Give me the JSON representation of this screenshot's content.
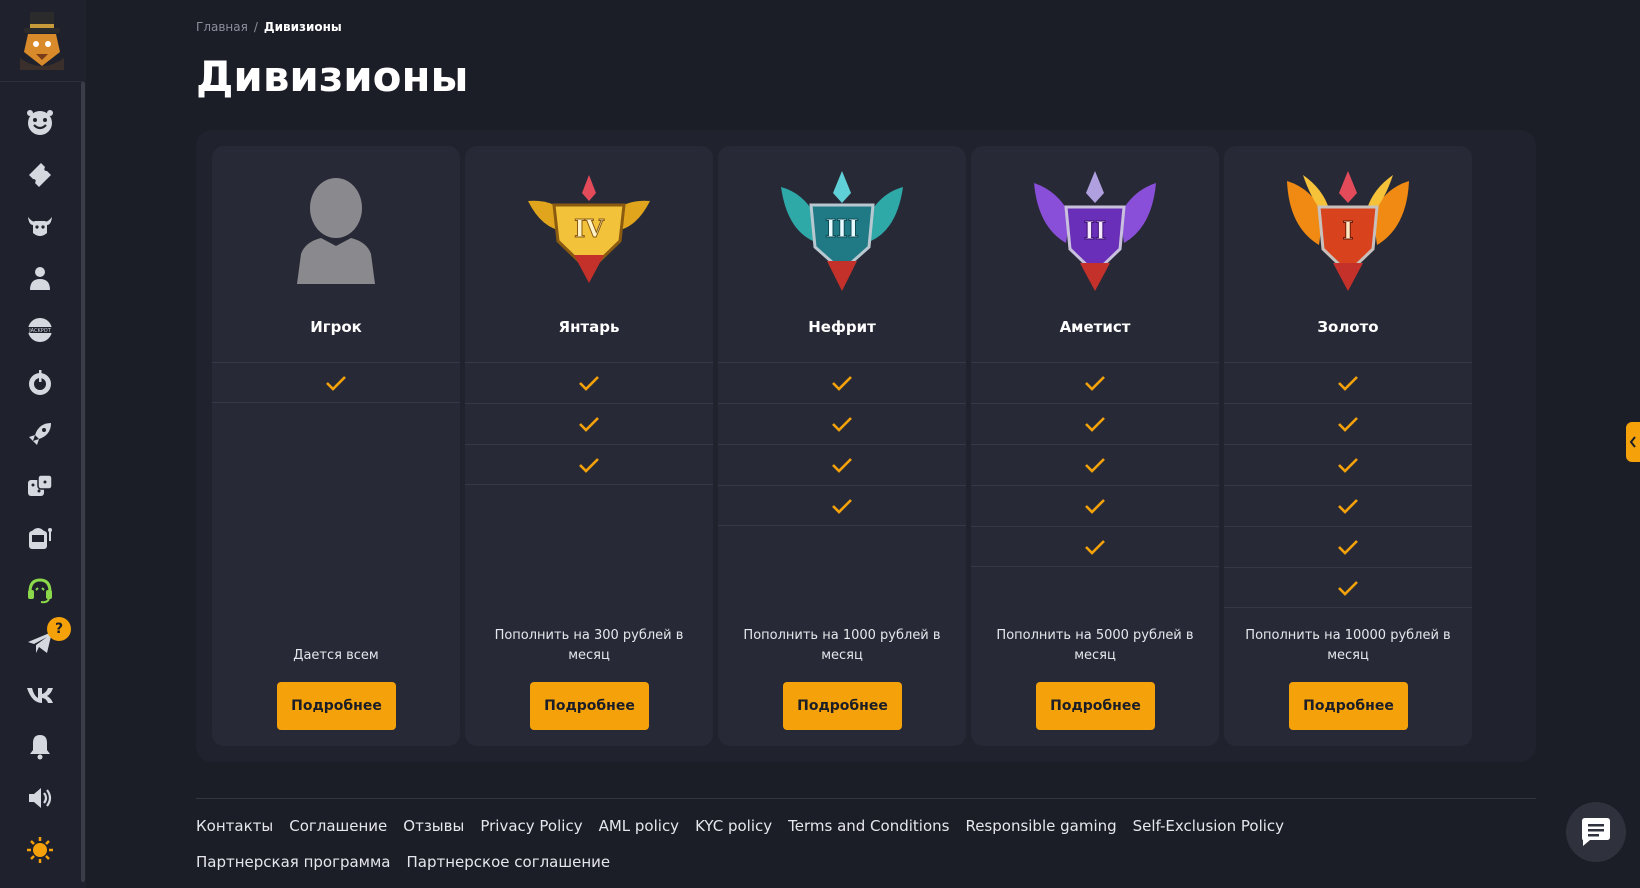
{
  "breadcrumb": {
    "home": "Главная",
    "separator": "/",
    "current": "Дивизионы"
  },
  "title": "Дивизионы",
  "sidebar": {
    "items": [
      {
        "icon": "smile-icon"
      },
      {
        "icon": "ticket-icon"
      },
      {
        "icon": "bull-icon"
      },
      {
        "icon": "user-icon"
      },
      {
        "icon": "jackpot-icon"
      },
      {
        "icon": "crash-icon"
      },
      {
        "icon": "rocket-icon"
      },
      {
        "icon": "dice-icon"
      },
      {
        "icon": "slot-icon"
      },
      {
        "icon": "support-icon"
      },
      {
        "icon": "telegram-icon",
        "badge": "?"
      },
      {
        "icon": "vk-icon"
      },
      {
        "icon": "bell-icon"
      },
      {
        "icon": "sound-icon"
      },
      {
        "icon": "theme-icon"
      }
    ]
  },
  "divisions": [
    {
      "name": "Игрок",
      "checks": 1,
      "description": "Дается всем",
      "button": "Подробнее",
      "badge_color": "#8a8a8e"
    },
    {
      "name": "Янтарь",
      "checks": 3,
      "description": "Пополнить на 300 рублей в месяц",
      "button": "Подробнее",
      "badge_color": "#e0a51c",
      "numeral": "IV"
    },
    {
      "name": "Нефрит",
      "checks": 4,
      "description": "Пополнить на 1000 рублей в месяц",
      "button": "Подробнее",
      "badge_color": "#2fa9a8",
      "numeral": "III"
    },
    {
      "name": "Аметист",
      "checks": 5,
      "description": "Пополнить на 5000 рублей в месяц",
      "button": "Подробнее",
      "badge_color": "#8a4fd8",
      "numeral": "II"
    },
    {
      "name": "Золото",
      "checks": 6,
      "description": "Пополнить на 10000 рублей в месяц",
      "button": "Подробнее",
      "badge_color": "#f08a12",
      "numeral": "I"
    }
  ],
  "footer": {
    "links": [
      "Контакты",
      "Соглашение",
      "Отзывы",
      "Privacy Policy",
      "AML policy",
      "KYC policy",
      "Terms and Conditions",
      "Responsible gaming",
      "Self-Exclusion Policy",
      "Партнерская программа",
      "Партнерское соглашение"
    ]
  },
  "colors": {
    "accent": "#f5a20a",
    "background": "#1b1d27",
    "card": "#272a36",
    "support_icon": "#8bd94a"
  }
}
